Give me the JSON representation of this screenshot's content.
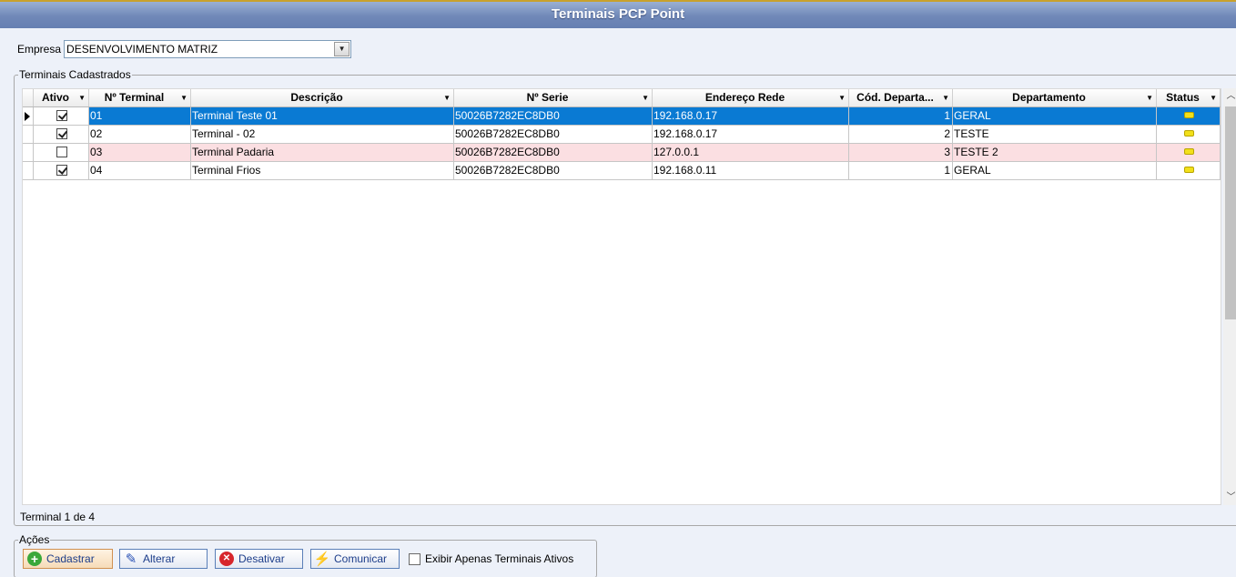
{
  "window": {
    "title": "Terminais PCP Point"
  },
  "empresa": {
    "label": "Empresa",
    "value": "DESENVOLVIMENTO MATRIZ"
  },
  "terminais": {
    "legend": "Terminais Cadastrados",
    "columns": [
      "Ativo",
      "Nº Terminal",
      "Descrição",
      "Nº Serie",
      "Endereço Rede",
      "Cód. Departa...",
      "Departamento",
      "Status"
    ],
    "rows": [
      {
        "ativo": true,
        "numero": "01",
        "descricao": "Terminal Teste 01",
        "serie": "50026B7282EC8DB0",
        "rede": "192.168.0.17",
        "cod_dep": "1",
        "departamento": "GERAL"
      },
      {
        "ativo": true,
        "numero": "02",
        "descricao": "Terminal - 02",
        "serie": "50026B7282EC8DB0",
        "rede": "192.168.0.17",
        "cod_dep": "2",
        "departamento": "TESTE"
      },
      {
        "ativo": false,
        "numero": "03",
        "descricao": "Terminal Padaria",
        "serie": "50026B7282EC8DB0",
        "rede": "127.0.0.1",
        "cod_dep": "3",
        "departamento": "TESTE 2"
      },
      {
        "ativo": true,
        "numero": "04",
        "descricao": "Terminal Frios",
        "serie": "50026B7282EC8DB0",
        "rede": "192.168.0.11",
        "cod_dep": "1",
        "departamento": "GERAL"
      }
    ],
    "footer": "Terminal 1 de 4",
    "status_color": "#f2e01a",
    "selected_color": "#0a7ad3",
    "inactive_row_color": "#fbdfe2"
  },
  "acoes": {
    "legend": "Ações",
    "cadastrar": "Cadastrar",
    "alterar": "Alterar",
    "desativar": "Desativar",
    "comunicar": "Comunicar",
    "exibir_ativos": "Exibir Apenas Terminais Ativos"
  },
  "icons": {
    "cadastrar": "plus-circle-icon",
    "alterar": "pen-icon",
    "desativar": "close-circle-icon",
    "comunicar": "lightning-icon"
  }
}
